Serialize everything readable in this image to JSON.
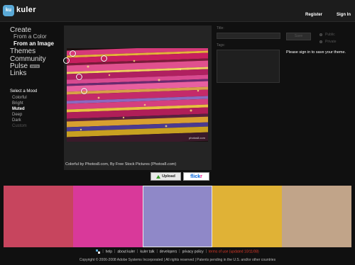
{
  "header": {
    "logo_text": "ku",
    "brand": "kuler",
    "register": "Register",
    "signin": "Sign In"
  },
  "nav": {
    "create": "Create",
    "from_color": "From a Color",
    "from_image": "From an Image",
    "themes": "Themes",
    "community": "Community",
    "pulse": "Pulse",
    "beta": "BETA",
    "links": "Links"
  },
  "mood": {
    "title": "Select a Mood",
    "options": [
      "Colorful",
      "Bright",
      "Muted",
      "Deep",
      "Dark",
      "Custom"
    ],
    "selected": "Muted"
  },
  "image": {
    "credit": "Colorful by Photos8.com, By Free Stock Pictures (Photos8.com)",
    "watermark": "photos8.com"
  },
  "actions": {
    "upload": "Upload",
    "flickr_a": "flick",
    "flickr_b": "r"
  },
  "theme_form": {
    "title_label": "Title:",
    "tags_label": "Tags:",
    "save": "Save",
    "public": "Public",
    "private": "Private",
    "signin_note": "Please sign in to save your theme."
  },
  "swatches": [
    "#c7455e",
    "#d9399a",
    "#8f88c8",
    "#e0b236",
    "#c1a489"
  ],
  "footer": {
    "help": "help",
    "about": "about kuler",
    "talk": "kuler talk",
    "developers": "developers",
    "privacy": "privacy policy",
    "terms": "terms of use (updated 10/11/08)",
    "copyright": "Copyright © 2006-2008 Adobe Systems Incorporated | All rights reserved | Patents pending in the U.S. and/or other countries"
  },
  "colors": {
    "accent": "#5aa9d6",
    "terms": "#e03a2a"
  }
}
